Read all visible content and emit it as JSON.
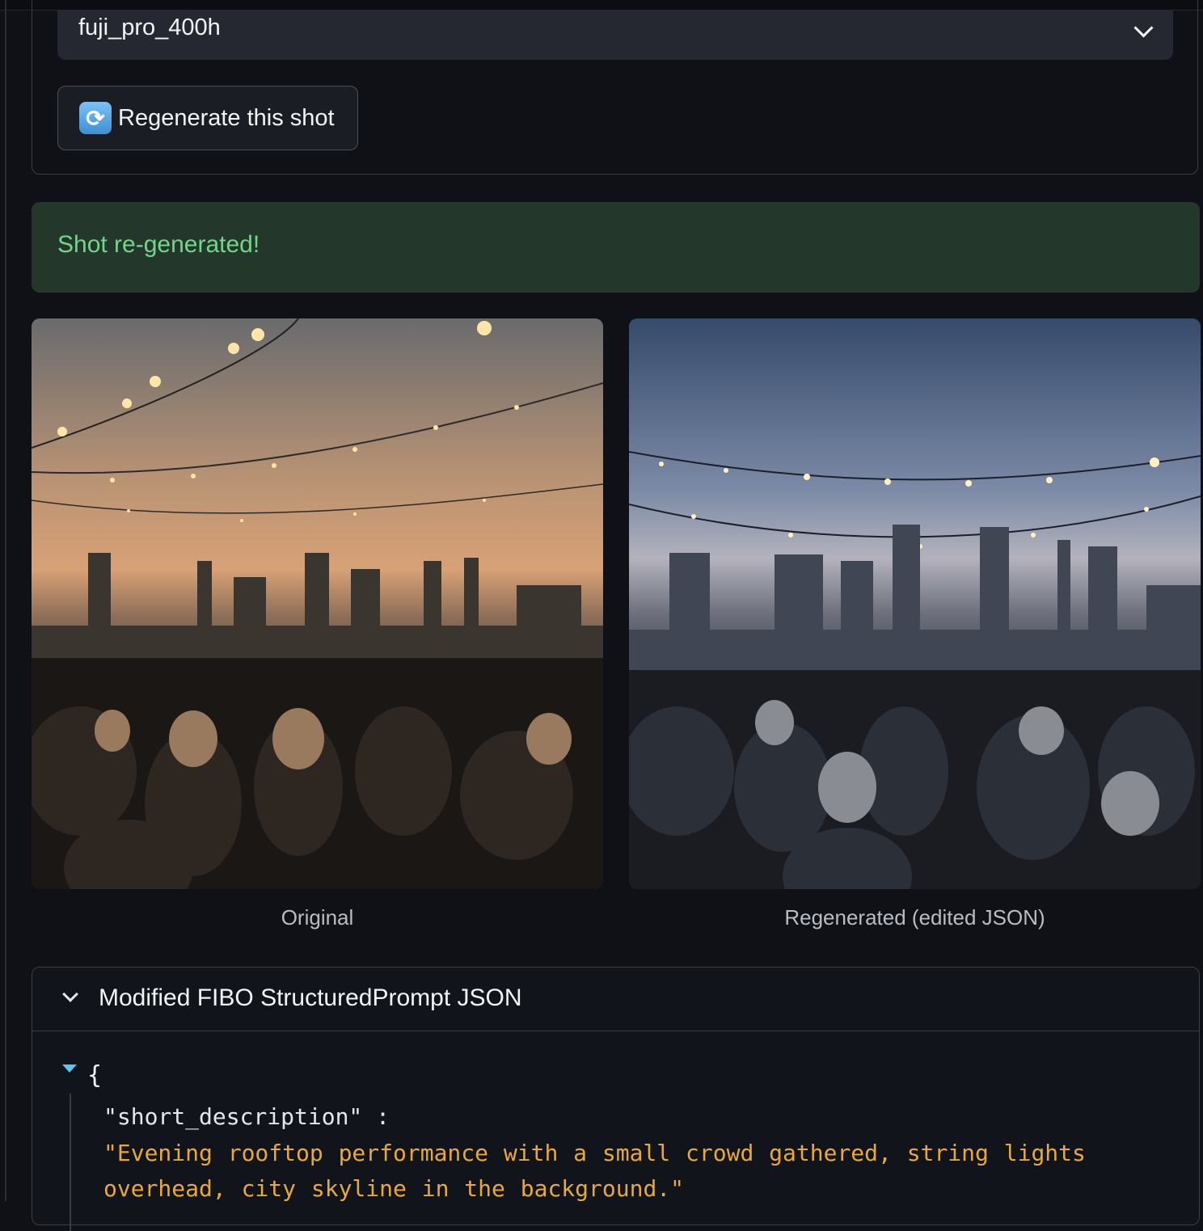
{
  "film_select": {
    "value": "fuji_pro_400h"
  },
  "regen_button": {
    "icon": "refresh-icon",
    "label": "Regenerate this shot"
  },
  "status": {
    "message": "Shot re-generated!"
  },
  "images": {
    "original_caption": "Original",
    "regenerated_caption": "Regenerated (edited JSON)"
  },
  "accordion": {
    "title": "Modified FIBO StructuredPrompt JSON",
    "open_brace": "{",
    "key": "\"short_description\" :",
    "value": "\"Evening rooftop performance with a small crowd gathered, string lights overhead, city skyline in the background.\""
  },
  "colors": {
    "accent_success": "#72d68a",
    "json_string": "#e9a83a",
    "toggle_blue": "#5cc6f0"
  }
}
